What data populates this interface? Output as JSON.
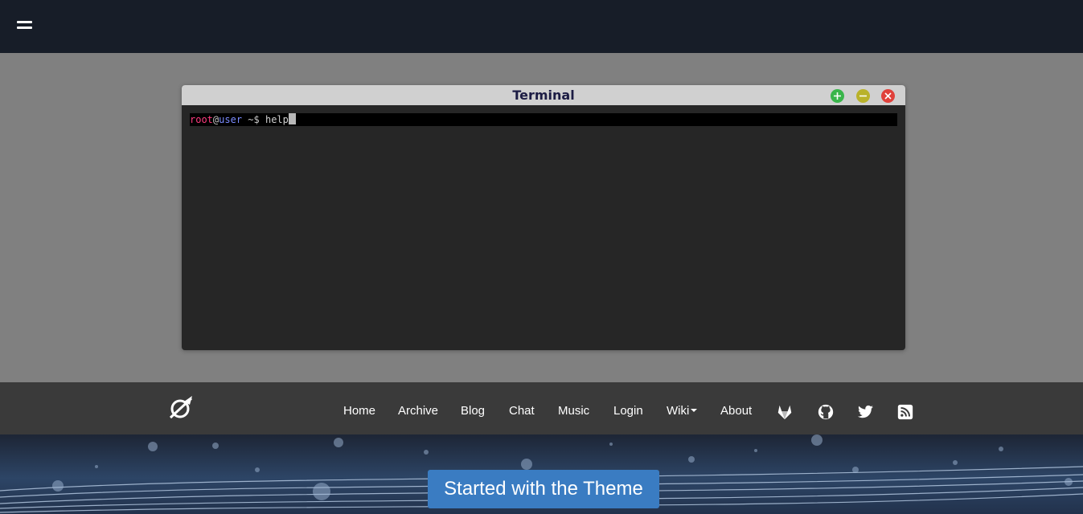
{
  "terminal": {
    "title": "Terminal",
    "prompt_user": "root",
    "prompt_at": "@",
    "prompt_host": "user",
    "prompt_symbol": "~$",
    "command": "help"
  },
  "nav": {
    "items": [
      {
        "label": "Home"
      },
      {
        "label": "Archive"
      },
      {
        "label": "Blog"
      },
      {
        "label": "Chat"
      },
      {
        "label": "Music"
      },
      {
        "label": "Login"
      },
      {
        "label": "Wiki"
      },
      {
        "label": "About"
      }
    ],
    "social_icons": [
      "gitlab-icon",
      "github-icon",
      "twitter-icon",
      "rss-icon"
    ]
  },
  "hero": {
    "cta_label": "Started with the Theme"
  },
  "colors": {
    "topbar": "#171d28",
    "page_background": "#808080",
    "terminal_background": "#262626",
    "terminal_titlebar": "#d0d0d0",
    "navbar": "#3a3a3a",
    "cta": "#3a7cc2",
    "prompt_user": "#ff3b7f",
    "prompt_host": "#7b8cff"
  }
}
